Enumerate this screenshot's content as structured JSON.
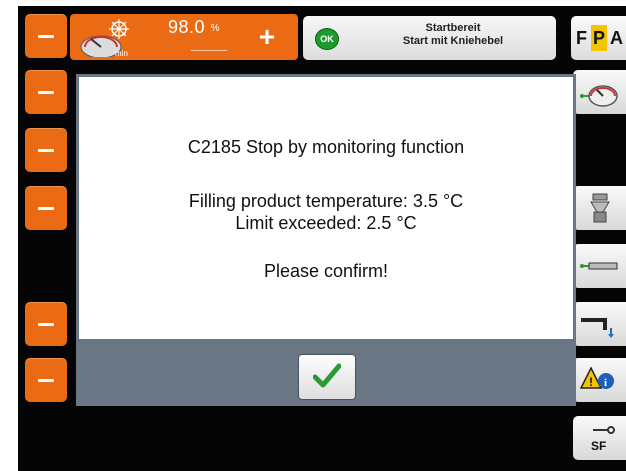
{
  "header": {
    "percent_value": "98.0",
    "percent_unit": "%",
    "gauge_label": "min",
    "plus_label": "+"
  },
  "status": {
    "badge": "OK",
    "line1": "Startbereit",
    "line2": "Start mit Kniehebel"
  },
  "brand": {
    "f": "F",
    "p": "P",
    "a": "A"
  },
  "dialog": {
    "title": "C2185 Stop by monitoring function",
    "line1": "Filling product temperature: 3.5 °C",
    "line2": "Limit exceeded: 2.5 °C",
    "prompt": "Please confirm!"
  },
  "side": {
    "sf_label": "SF"
  },
  "colors": {
    "accent": "#ea6b14",
    "ok": "#1d9b2e",
    "confirm": "#2a9a32"
  }
}
